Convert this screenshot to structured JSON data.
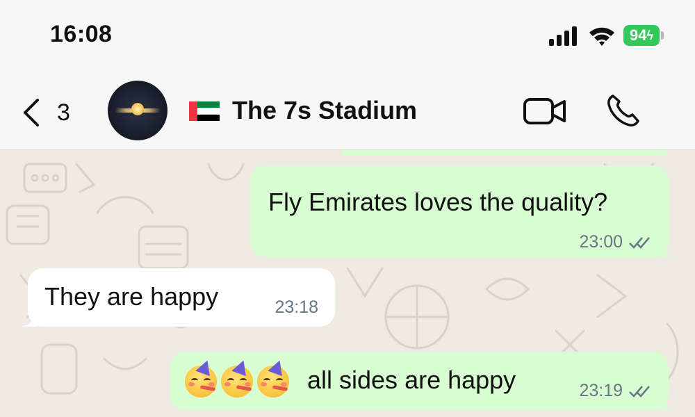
{
  "status_bar": {
    "time": "16:08",
    "battery_level": "94",
    "signal_icon": "signal-icon",
    "wifi_icon": "wifi-icon"
  },
  "header": {
    "back_count": "3",
    "chat_title": "The 7s Stadium",
    "flag": "UAE flag",
    "actions": [
      "video-call-icon",
      "phone-icon"
    ]
  },
  "messages": [
    {
      "direction": "outgoing",
      "text": "Fly Emirates loves the quality?",
      "time": "23:00",
      "status": "read"
    },
    {
      "direction": "incoming",
      "text": "They are happy",
      "time": "23:18"
    },
    {
      "direction": "outgoing",
      "emoji": "🥳🥳🥳",
      "text": "all sides are happy",
      "time": "23:19",
      "status": "read"
    }
  ],
  "colors": {
    "outgoing_bubble": "#d9fdd3",
    "incoming_bubble": "#ffffff",
    "chat_background": "#efeae2",
    "battery": "#34c759"
  }
}
